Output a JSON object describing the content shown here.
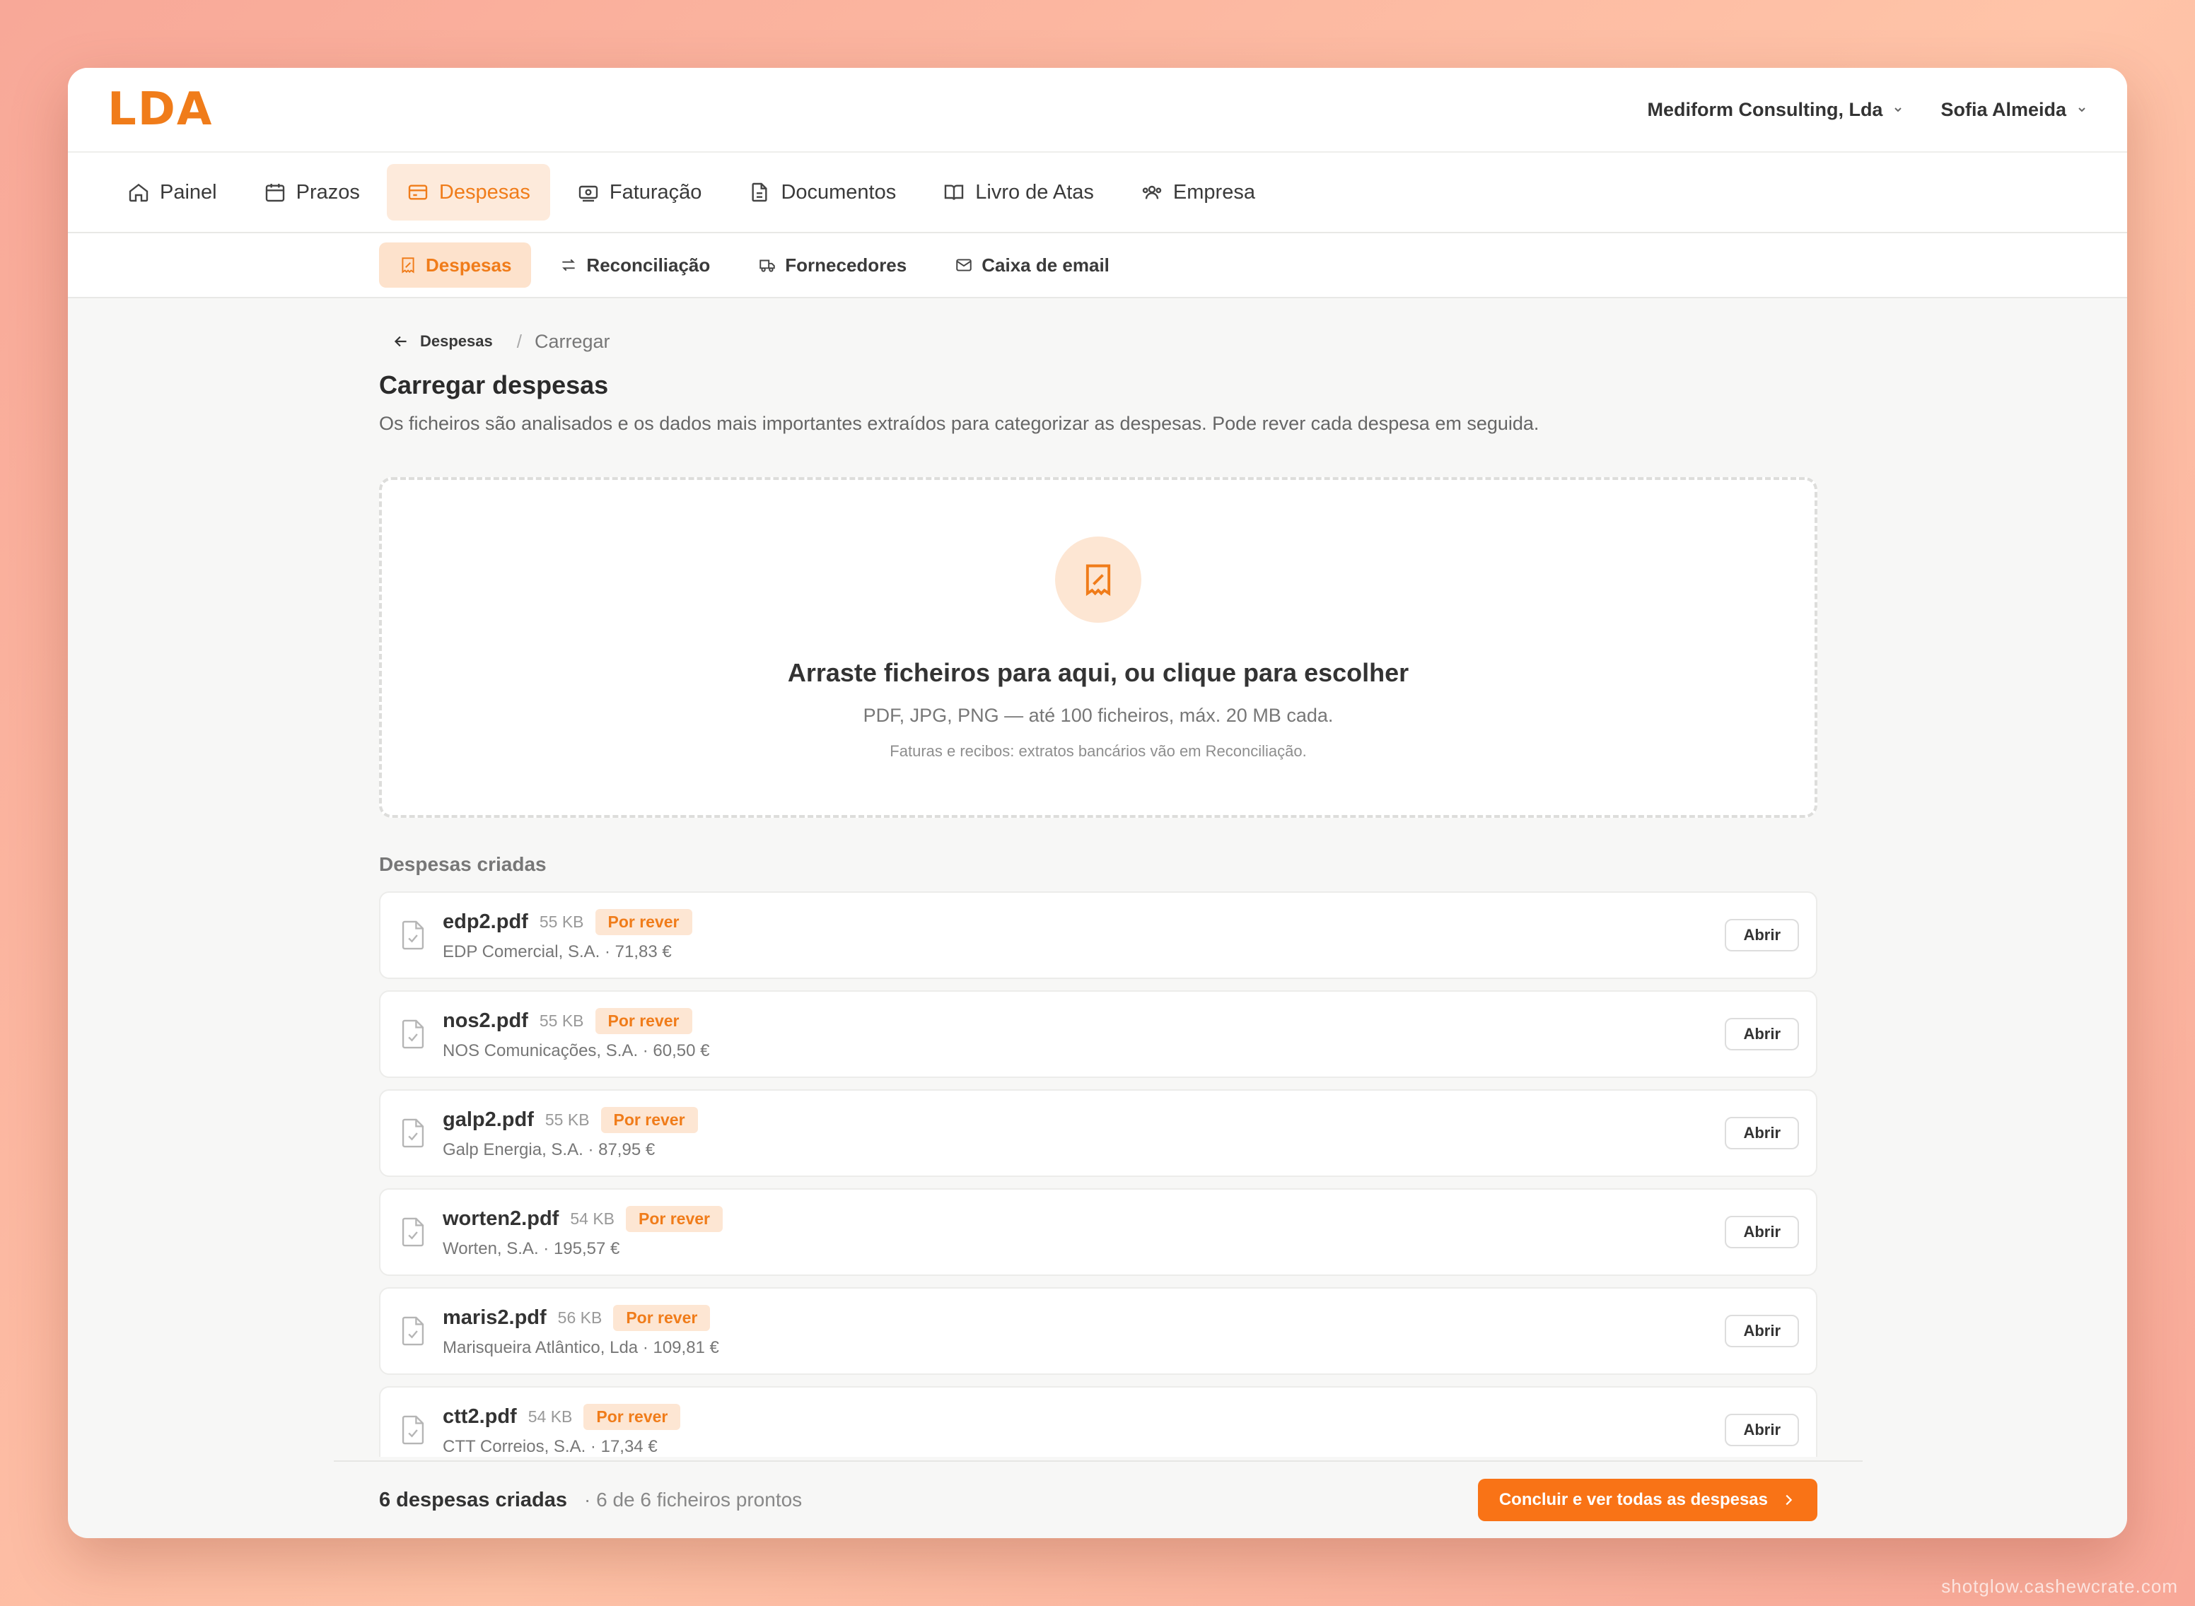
{
  "app": {
    "logo": "LDA"
  },
  "topbar": {
    "company": "Mediform Consulting, Lda",
    "user": "Sofia Almeida"
  },
  "main_nav": [
    {
      "label": "Painel",
      "icon": "home-icon"
    },
    {
      "label": "Prazos",
      "icon": "calendar-icon"
    },
    {
      "label": "Despesas",
      "icon": "credit-card-icon",
      "active": true
    },
    {
      "label": "Faturação",
      "icon": "banknote-icon"
    },
    {
      "label": "Documentos",
      "icon": "document-icon"
    },
    {
      "label": "Livro de Atas",
      "icon": "book-icon"
    },
    {
      "label": "Empresa",
      "icon": "users-icon"
    }
  ],
  "sub_nav": [
    {
      "label": "Despesas",
      "icon": "receipt-icon",
      "active": true
    },
    {
      "label": "Reconciliação",
      "icon": "swap-arrows-icon"
    },
    {
      "label": "Fornecedores",
      "icon": "truck-icon"
    },
    {
      "label": "Caixa de email",
      "icon": "mail-icon"
    }
  ],
  "breadcrumb": {
    "back": "Despesas",
    "separator": "/",
    "current": "Carregar"
  },
  "page": {
    "title": "Carregar despesas",
    "description": "Os ficheiros são analisados e os dados mais importantes extraídos para categorizar as despesas. Pode rever cada despesa em seguida."
  },
  "dropzone": {
    "title": "Arraste ficheiros para aqui, ou clique para escolher",
    "formats": "PDF, JPG, PNG — até 100 ficheiros, máx. 20 MB cada.",
    "note": "Faturas e recibos: extratos bancários vão em Reconciliação."
  },
  "list": {
    "heading": "Despesas criadas",
    "open_label": "Abrir",
    "rows": [
      {
        "name": "edp2.pdf",
        "size": "55 KB",
        "status": "Por rever",
        "detail": "EDP Comercial, S.A. · 71,83 €"
      },
      {
        "name": "nos2.pdf",
        "size": "55 KB",
        "status": "Por rever",
        "detail": "NOS Comunicações, S.A. · 60,50 €"
      },
      {
        "name": "galp2.pdf",
        "size": "55 KB",
        "status": "Por rever",
        "detail": "Galp Energia, S.A. · 87,95 €"
      },
      {
        "name": "worten2.pdf",
        "size": "54 KB",
        "status": "Por rever",
        "detail": "Worten, S.A. · 195,57 €"
      },
      {
        "name": "maris2.pdf",
        "size": "56 KB",
        "status": "Por rever",
        "detail": "Marisqueira Atlântico, Lda · 109,81 €"
      },
      {
        "name": "ctt2.pdf",
        "size": "54 KB",
        "status": "Por rever",
        "detail": "CTT Correios, S.A. · 17,34 €"
      }
    ]
  },
  "footer": {
    "count": "6 despesas criadas",
    "status": "· 6 de 6 ficheiros prontos",
    "button": "Concluir e ver todas as despesas"
  },
  "watermark": "shotglow.cashewcrate.com",
  "colors": {
    "accent": "#f07c1a",
    "accent_soft": "#fde6d3",
    "button": "#f97316"
  }
}
